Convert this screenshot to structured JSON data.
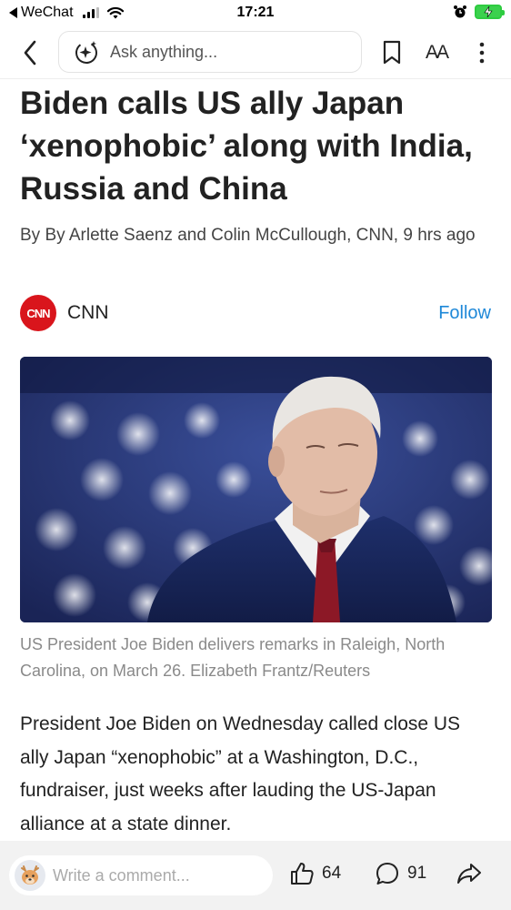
{
  "status_bar": {
    "carrier": "WeChat",
    "time": "17:21"
  },
  "nav": {
    "ask_placeholder": "Ask anything...",
    "font_size_label": "AA"
  },
  "article": {
    "headline": "Biden calls US ally Japan ‘xenophobic’ along with India, Russia and China",
    "byline": "By By Arlette Saenz and Colin McCullough, CNN, 9 hrs ago",
    "source": {
      "logo_text": "CNN",
      "name": "CNN",
      "follow_label": "Follow"
    },
    "image": {
      "icon": "photo-biden-flag-background"
    },
    "caption": "US President Joe Biden delivers remarks in Raleigh, North Carolina, on March 26. Elizabeth Frantz/Reuters",
    "body": "President Joe Biden on Wednesday called close US ally Japan “xenophobic” at a Washington, D.C., fundraiser, just weeks after lauding the US-Japan alliance at a state dinner."
  },
  "bottom_bar": {
    "comment_placeholder": "Write a comment...",
    "likes": "64",
    "comments": "91"
  },
  "colors": {
    "accent_blue": "#1e88d8",
    "cnn_red": "#d9151c",
    "battery_green": "#3bd14d"
  }
}
